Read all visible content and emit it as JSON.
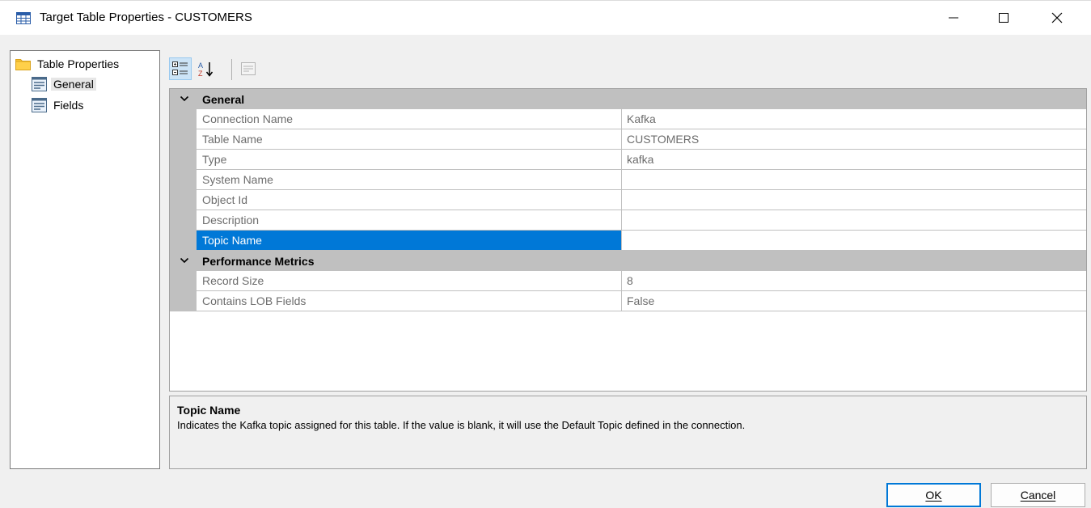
{
  "window": {
    "title": "Target Table Properties - CUSTOMERS",
    "icon": "table-icon",
    "controls": [
      "minimize-icon",
      "maximize-icon",
      "close-icon"
    ]
  },
  "tree": {
    "root": {
      "label": "Table Properties",
      "icon": "folder-icon"
    },
    "items": [
      {
        "label": "General",
        "icon": "page-icon",
        "selected": true
      },
      {
        "label": "Fields",
        "icon": "page-icon",
        "selected": false
      }
    ]
  },
  "toolbar": {
    "buttons": [
      {
        "name": "categorized",
        "icon": "categorized-icon",
        "active": true
      },
      {
        "name": "alphabetical",
        "icon": "sort-az-icon",
        "active": false
      },
      {
        "name": "property-pages",
        "icon": "property-pages-icon",
        "active": false,
        "disabled": true
      }
    ]
  },
  "grid": {
    "categories": [
      {
        "label": "General",
        "rows": [
          {
            "name": "Connection Name",
            "value": "Kafka"
          },
          {
            "name": "Table Name",
            "value": "CUSTOMERS"
          },
          {
            "name": "Type",
            "value": "kafka"
          },
          {
            "name": "System Name",
            "value": ""
          },
          {
            "name": "Object Id",
            "value": ""
          },
          {
            "name": "Description",
            "value": ""
          },
          {
            "name": "Topic Name",
            "value": "",
            "selected": true
          }
        ]
      },
      {
        "label": "Performance Metrics",
        "rows": [
          {
            "name": "Record Size",
            "value": "8"
          },
          {
            "name": "Contains LOB Fields",
            "value": "False"
          }
        ]
      }
    ]
  },
  "description": {
    "title": "Topic Name",
    "text": "Indicates the Kafka topic assigned for this table. If the value is blank, it will use the Default Topic defined in the connection."
  },
  "buttons": {
    "ok": "OK",
    "cancel": "Cancel"
  },
  "colors": {
    "selection": "#0078d7",
    "category_bg": "#c0c0c0",
    "value_text": "#6d6d6d"
  }
}
